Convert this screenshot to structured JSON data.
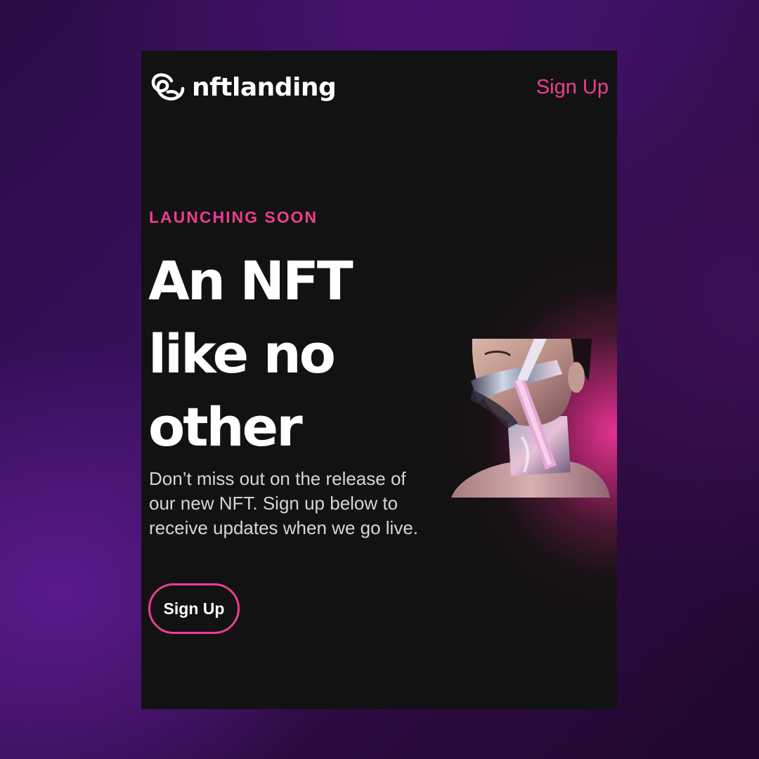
{
  "header": {
    "logo_text": "nftlanding",
    "signup_link": "Sign Up"
  },
  "hero": {
    "eyebrow": "LAUNCHING SOON",
    "headline": "An NFT like no other",
    "description": "Don’t miss out on the release of our new NFT. Sign up below to receive updates when we go live.",
    "cta_label": "Sign Up"
  },
  "colors": {
    "accent": "#ec3e8f",
    "panel_bg": "#121212",
    "page_bg": "#3a1060",
    "text": "#ffffff"
  },
  "icons": {
    "logo": "nftlanding-logo-icon"
  }
}
